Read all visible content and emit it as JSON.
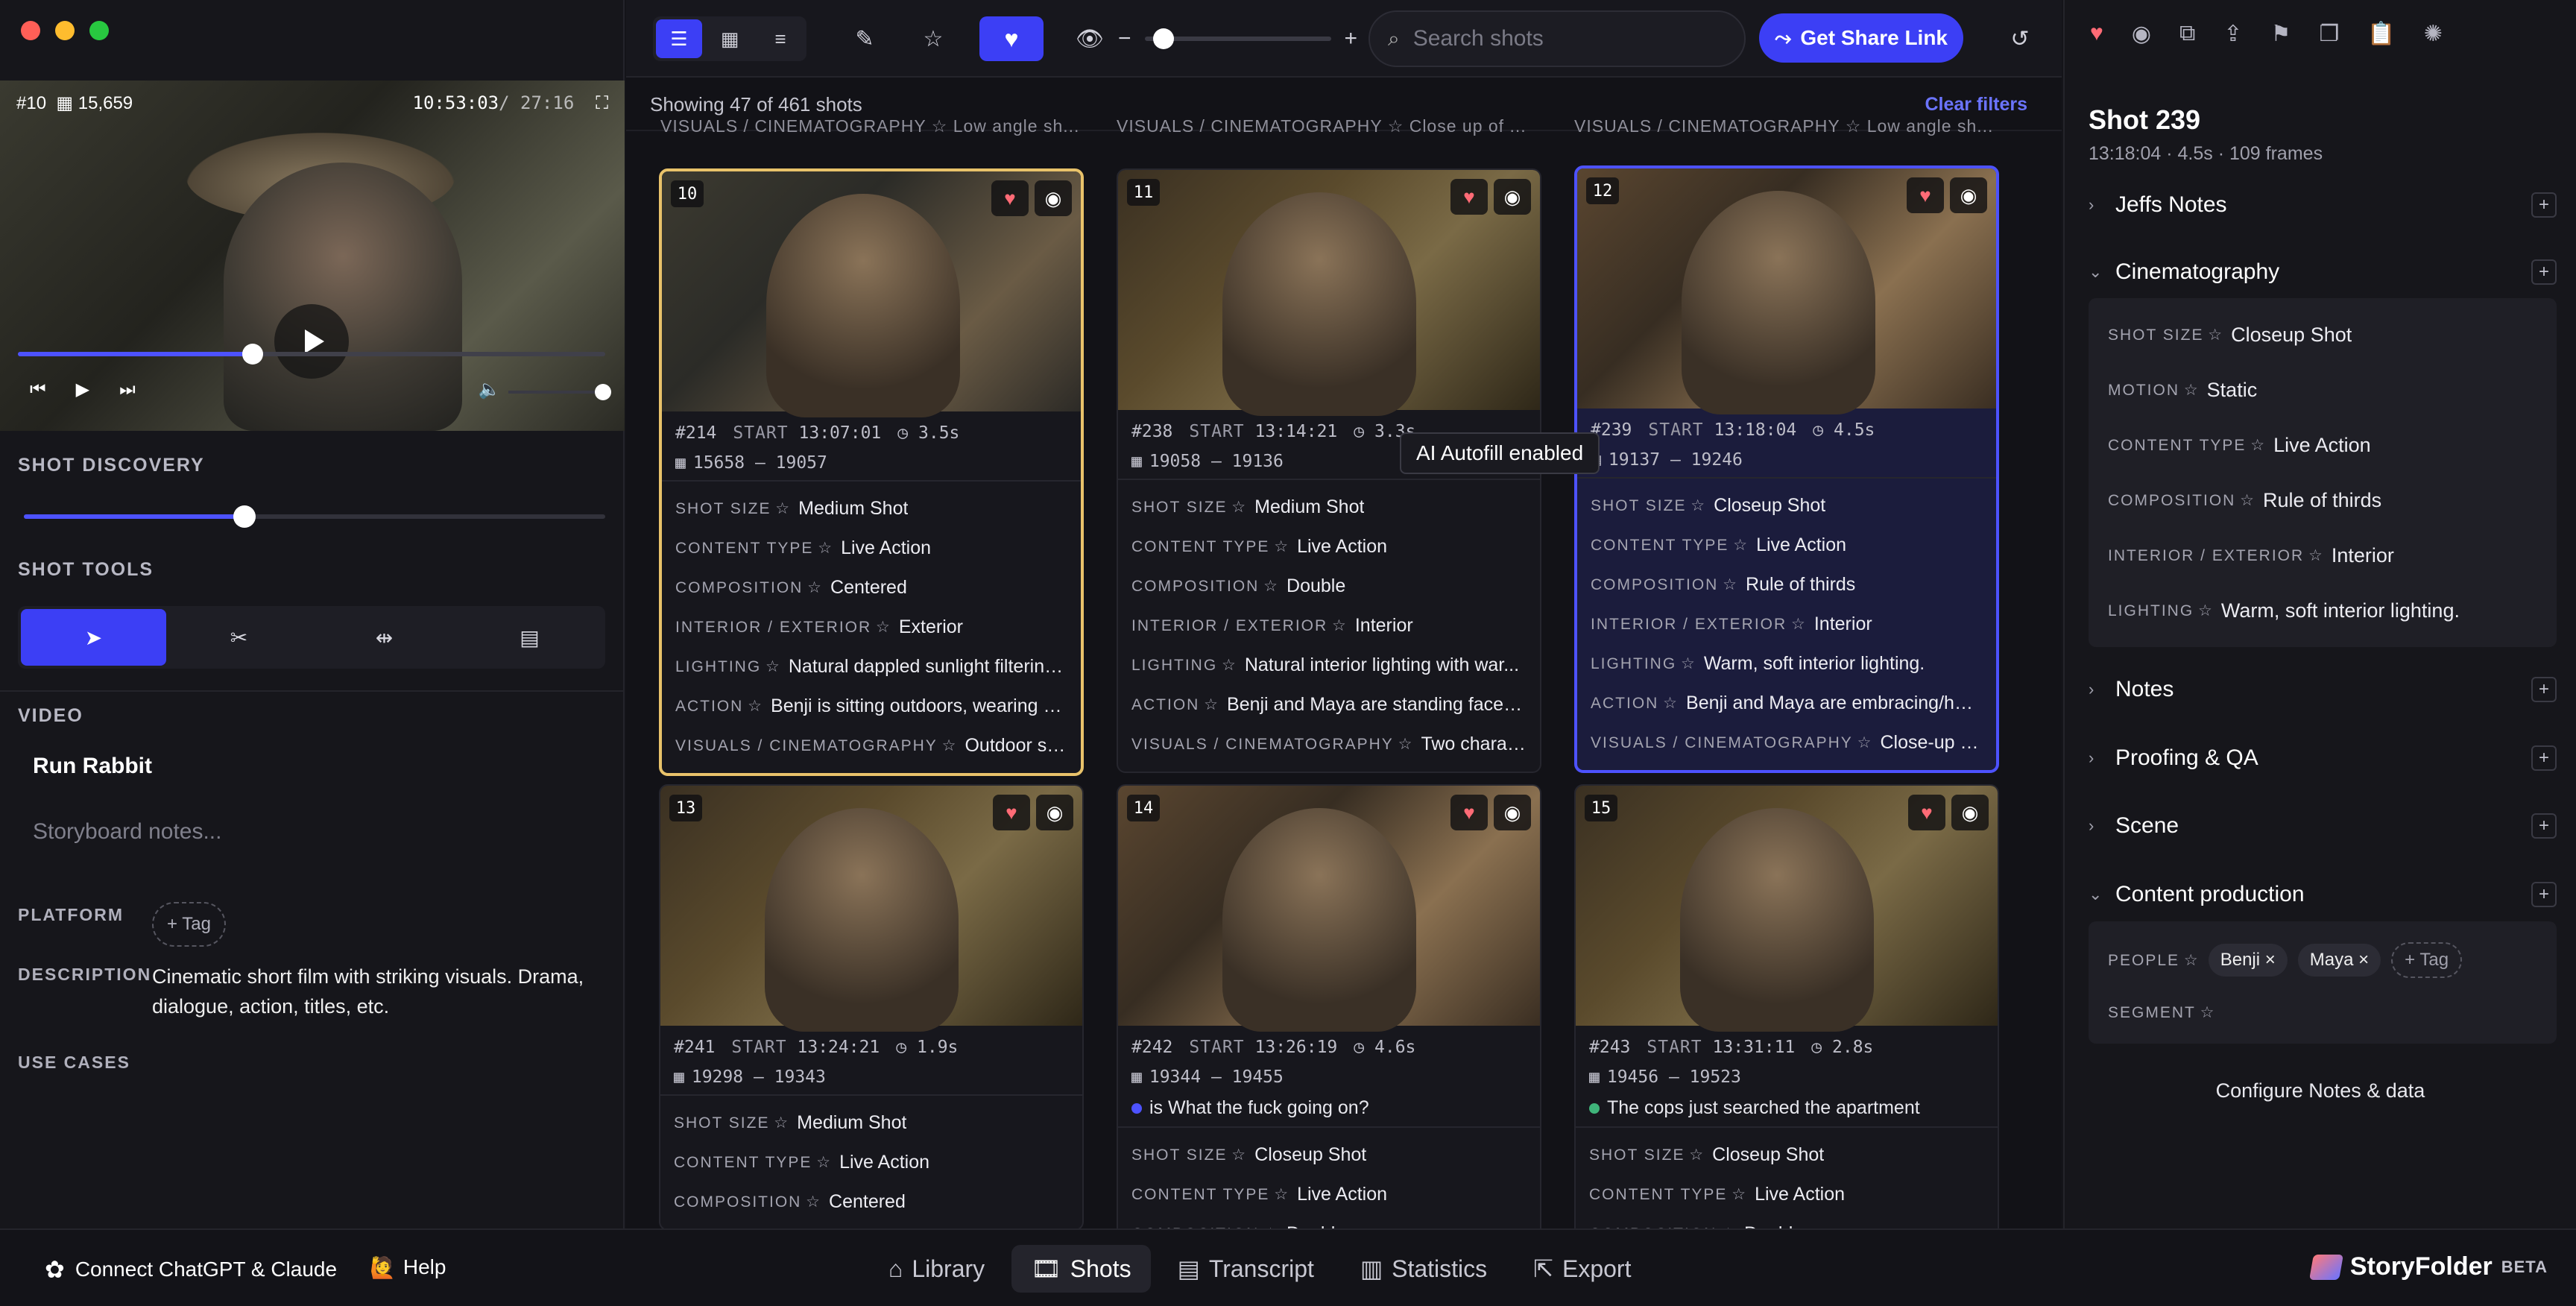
{
  "colors": {
    "accent": "#3c3ff5",
    "heart": "#ff6b76",
    "selected_yellow": "#e8c26a"
  },
  "left": {
    "video": {
      "shot_label": "#10",
      "frame_count": "15,659",
      "timecode": "10:53:03",
      "duration": "/ 27:16",
      "progress": 0.4,
      "volume": 1.0
    },
    "discovery": {
      "label": "SHOT DISCOVERY",
      "value": 0.38
    },
    "tools": {
      "label": "SHOT TOOLS",
      "items": [
        "select-tool",
        "cut-tool",
        "split-tool",
        "calendar-tool"
      ]
    },
    "video_section": {
      "label": "VIDEO",
      "name": "Run Rabbit",
      "notes_placeholder": "Storyboard notes..."
    },
    "platform": {
      "label": "PLATFORM",
      "tag": "+ Tag"
    },
    "description": {
      "label": "DESCRIPTION",
      "text": "Cinematic short film with striking visuals. Drama, dialogue, action, titles, etc."
    },
    "use_cases": {
      "label": "USE CASES"
    }
  },
  "toolbar": {
    "search_placeholder": "Search shots",
    "share_label": "Get Share Link",
    "zoom_level": 0.1
  },
  "grid": {
    "showing_text": "Showing 47 of 461 shots",
    "clear_filters": "Clear filters",
    "prev_row": [
      "VISUALS / CINEMATOGRAPHY ☆ Low angle sh...",
      "VISUALS / CINEMATOGRAPHY ☆ Close up of ...",
      "VISUALS / CINEMATOGRAPHY ☆ Low angle sh..."
    ],
    "tooltip": "AI Autofill enabled",
    "cards": [
      {
        "num": "10",
        "id": "#214",
        "start_label": "START",
        "start": "13:07:01",
        "dur": "3.5s",
        "frames": "15658 – 19057",
        "attrs": [
          [
            "SHOT SIZE",
            "Medium Shot"
          ],
          [
            "CONTENT TYPE",
            "Live Action"
          ],
          [
            "COMPOSITION",
            "Centered"
          ],
          [
            "INTERIOR / EXTERIOR",
            "Exterior"
          ],
          [
            "LIGHTING",
            "Natural dappled sunlight filtering..."
          ],
          [
            "ACTION",
            "Benji is sitting outdoors, wearing a..."
          ],
          [
            "VISUALS / CINEMATOGRAPHY",
            "Outdoor sho..."
          ]
        ]
      },
      {
        "num": "11",
        "id": "#238",
        "start_label": "START",
        "start": "13:14:21",
        "dur": "3.3s",
        "frames": "19058 – 19136",
        "attrs": [
          [
            "SHOT SIZE",
            "Medium Shot"
          ],
          [
            "CONTENT TYPE",
            "Live Action"
          ],
          [
            "COMPOSITION",
            "Double"
          ],
          [
            "INTERIOR / EXTERIOR",
            "Interior"
          ],
          [
            "LIGHTING",
            "Natural interior lighting with war..."
          ],
          [
            "ACTION",
            "Benji and Maya are standing face-t..."
          ],
          [
            "VISUALS / CINEMATOGRAPHY",
            "Two characte..."
          ]
        ]
      },
      {
        "num": "12",
        "id": "#239",
        "start_label": "START",
        "start": "13:18:04",
        "dur": "4.5s",
        "frames": "19137 – 19246",
        "attrs": [
          [
            "SHOT SIZE",
            "Closeup Shot"
          ],
          [
            "CONTENT TYPE",
            "Live Action"
          ],
          [
            "COMPOSITION",
            "Rule of thirds"
          ],
          [
            "INTERIOR / EXTERIOR",
            "Interior"
          ],
          [
            "LIGHTING",
            "Warm, soft interior lighting."
          ],
          [
            "ACTION",
            "Benji and Maya are embracing/hug..."
          ],
          [
            "VISUALS / CINEMATOGRAPHY",
            "Close-up of ..."
          ]
        ]
      },
      {
        "num": "13",
        "id": "#241",
        "start_label": "START",
        "start": "13:24:21",
        "dur": "1.9s",
        "frames": "19298 – 19343",
        "subtitle": "",
        "attrs": [
          [
            "SHOT SIZE",
            "Medium Shot"
          ],
          [
            "CONTENT TYPE",
            "Live Action"
          ],
          [
            "COMPOSITION",
            "Centered"
          ]
        ]
      },
      {
        "num": "14",
        "id": "#242",
        "start_label": "START",
        "start": "13:26:19",
        "dur": "4.6s",
        "frames": "19344 – 19455",
        "subtitle": "is What the fuck going on?",
        "attrs": [
          [
            "SHOT SIZE",
            "Closeup Shot"
          ],
          [
            "CONTENT TYPE",
            "Live Action"
          ],
          [
            "COMPOSITION",
            "Double"
          ]
        ]
      },
      {
        "num": "15",
        "id": "#243",
        "start_label": "START",
        "start": "13:31:11",
        "dur": "2.8s",
        "frames": "19456 – 19523",
        "subtitle": "The cops just searched the apartment",
        "attrs": [
          [
            "SHOT SIZE",
            "Closeup Shot"
          ],
          [
            "CONTENT TYPE",
            "Live Action"
          ],
          [
            "COMPOSITION",
            "Double"
          ]
        ]
      }
    ]
  },
  "right": {
    "title": "Shot 239",
    "subtitle": "13:18:04 · 4.5s · 109 frames",
    "sections": {
      "jeffs_notes": "Jeffs Notes",
      "cinematography": "Cinematography",
      "notes": "Notes",
      "proofing": "Proofing & QA",
      "scene": "Scene",
      "content_production": "Content production"
    },
    "cinematography": [
      [
        "SHOT SIZE",
        "Closeup Shot"
      ],
      [
        "MOTION",
        "Static"
      ],
      [
        "CONTENT TYPE",
        "Live Action"
      ],
      [
        "COMPOSITION",
        "Rule of thirds"
      ],
      [
        "INTERIOR / EXTERIOR",
        "Interior"
      ],
      [
        "LIGHTING",
        "Warm, soft interior lighting."
      ]
    ],
    "people_label": "PEOPLE",
    "people": [
      "Benji",
      "Maya"
    ],
    "add_tag": "+ Tag",
    "segment_label": "SEGMENT",
    "configure": "Configure Notes & data"
  },
  "bottom": {
    "connect": "Connect ChatGPT & Claude",
    "help": "Help",
    "tabs": [
      "Library",
      "Shots",
      "Transcript",
      "Statistics",
      "Export"
    ],
    "active_tab": "Shots",
    "brand": "StoryFolder",
    "brand_tag": "BETA"
  }
}
